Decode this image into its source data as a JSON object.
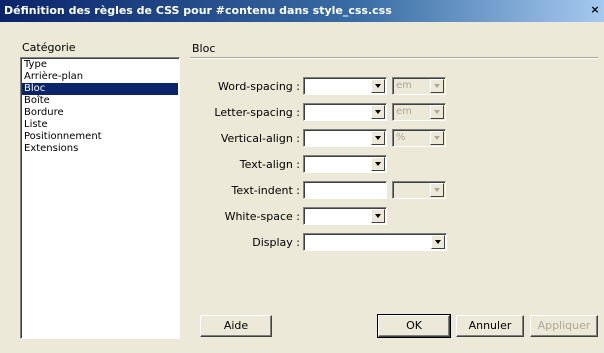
{
  "window": {
    "title": "Définition des règles de CSS pour #contenu dans style_css.css",
    "close_glyph": "×"
  },
  "category": {
    "label": "Catégorie",
    "items": [
      "Type",
      "Arrière-plan",
      "Bloc",
      "Boîte",
      "Bordure",
      "Liste",
      "Positionnement",
      "Extensions"
    ],
    "selected": "Bloc"
  },
  "section": {
    "title": "Bloc",
    "rows": {
      "word_spacing": {
        "label": "Word-spacing :",
        "value": "",
        "unit": "em"
      },
      "letter_spacing": {
        "label": "Letter-spacing :",
        "value": "",
        "unit": "em"
      },
      "vertical_align": {
        "label": "Vertical-align :",
        "value": "",
        "unit": "%"
      },
      "text_align": {
        "label": "Text-align :",
        "value": ""
      },
      "text_indent": {
        "label": "Text-indent :",
        "value": "",
        "unit": ""
      },
      "white_space": {
        "label": "White-space :",
        "value": ""
      },
      "display": {
        "label": "Display :",
        "value": ""
      }
    }
  },
  "buttons": {
    "help": "Aide",
    "ok": "OK",
    "cancel": "Annuler",
    "apply": "Appliquer"
  },
  "colors": {
    "titlebar_start": "#0a246a",
    "titlebar_end": "#a6caf0",
    "selection": "#0a246a",
    "face": "#ece9d8"
  }
}
